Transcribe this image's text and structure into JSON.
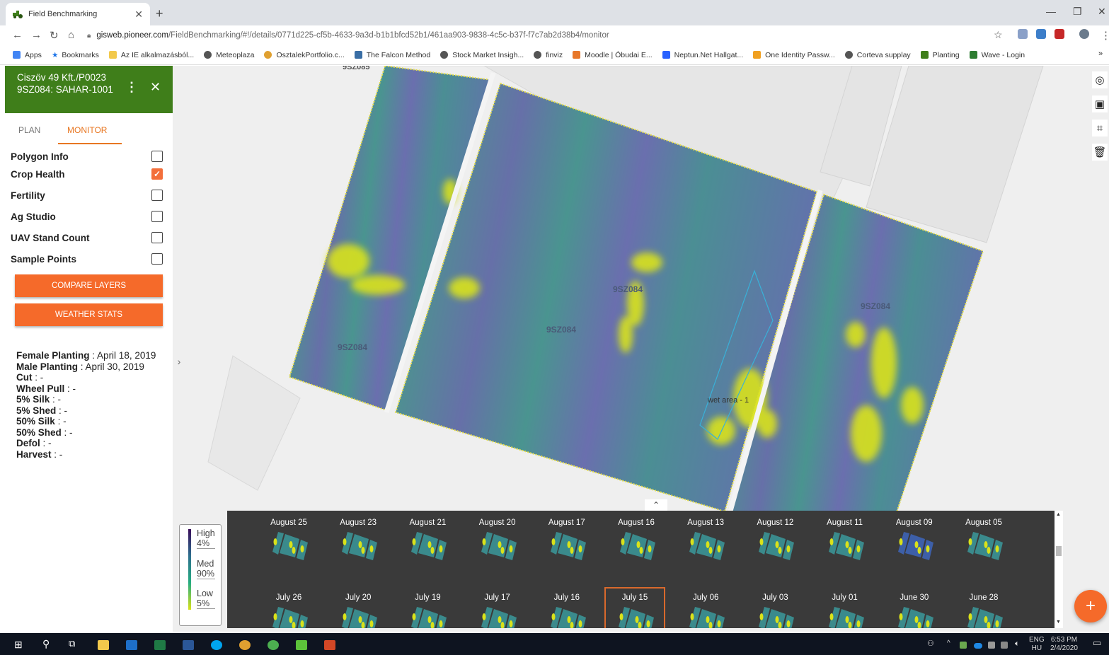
{
  "browser": {
    "tab_title": "Field Benchmarking",
    "url_host": "gisweb.pioneer.com",
    "url_path": "/FieldBenchmarking/#!/details/0771d225-cf5b-4633-9a3d-b1b1bfcd52b1/461aa903-9838-4c5c-b37f-f7c7ab2d38b4/monitor",
    "bookmarks": [
      "Apps",
      "Bookmarks",
      "Az IE alkalmazásból...",
      "Meteoplaza",
      "OsztalekPortfolio.c...",
      "The Falcon Method",
      "Stock Market Insigh...",
      "finviz",
      "Moodle | Óbudai E...",
      "Neptun.Net Hallgat...",
      "One Identity Passw...",
      "Corteva supplay",
      "Planting",
      "Wave - Login"
    ],
    "bookmarks_more": "»"
  },
  "panel": {
    "title": "Ciszöv 49 Kft./P0023 9SZ084: SAHAR-1001",
    "tabs": [
      "PLAN",
      "MONITOR"
    ],
    "layers": [
      {
        "label": "Polygon Info",
        "checked": false
      },
      {
        "label": "Crop Health",
        "checked": true
      },
      {
        "label": "Fertility",
        "checked": false
      },
      {
        "label": "Ag Studio",
        "checked": false
      },
      {
        "label": "UAV Stand Count",
        "checked": false
      },
      {
        "label": "Sample Points",
        "checked": false
      }
    ],
    "compare_btn": "COMPARE LAYERS",
    "weather_btn": "WEATHER STATS",
    "dates": [
      {
        "k": "Female Planting",
        "v": ": April 18, 2019"
      },
      {
        "k": "Male Planting",
        "v": ": April 30, 2019"
      },
      {
        "k": "Cut",
        "v": ": -"
      },
      {
        "k": "Wheel Pull",
        "v": ": -"
      },
      {
        "k": "5% Silk",
        "v": ": -"
      },
      {
        "k": "5% Shed",
        "v": ": -"
      },
      {
        "k": "50% Silk",
        "v": ": -"
      },
      {
        "k": "50% Shed",
        "v": ": -"
      },
      {
        "k": "Defol",
        "v": ": -"
      },
      {
        "k": "Harvest",
        "v": ": -"
      }
    ]
  },
  "map": {
    "field_labels": [
      "9SZ084",
      "9SZ084",
      "9SZ084",
      "9SZ084",
      "9SZ085"
    ],
    "zone_label": "wet area - 1"
  },
  "legend": {
    "high": "High",
    "high_pct": "4%",
    "med": "Med",
    "med_pct": "90%",
    "low": "Low",
    "low_pct": "5%"
  },
  "timeline": {
    "row1": [
      "August 25",
      "August 23",
      "August 21",
      "August 20",
      "August 17",
      "August 16",
      "August 13",
      "August 12",
      "August 11",
      "August 09",
      "August 05"
    ],
    "row2": [
      "July 26",
      "July 20",
      "July 19",
      "July 17",
      "July 16",
      "July 15",
      "July 06",
      "July 03",
      "July 01",
      "June 30",
      "June 28"
    ],
    "selected": "July 15"
  },
  "taskbar": {
    "lang": "ENG",
    "region": "HU",
    "time": "6:53 PM",
    "date": "2/4/2020"
  },
  "colors": {
    "header_green": "#3f7e1a",
    "accent_orange": "#f56a2a",
    "crop_low": "#d9e21a",
    "crop_med": "#4b8b8a",
    "crop_high": "#5a5aa0"
  }
}
